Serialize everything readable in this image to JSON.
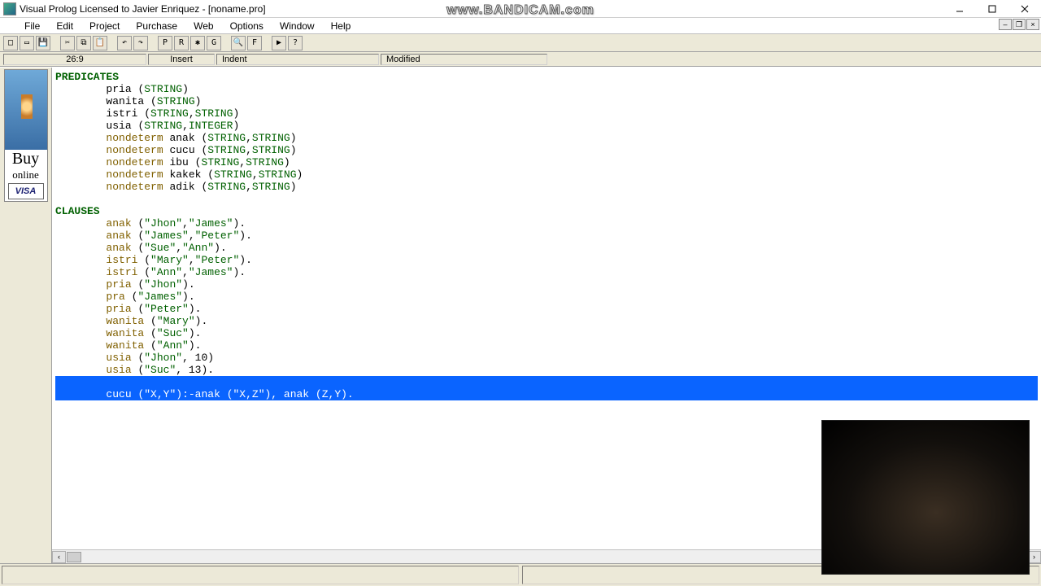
{
  "window": {
    "title": "Visual Prolog Licensed to Javier Enriquez - [noname.pro]",
    "watermark": "www.BANDICAM.com"
  },
  "menu": {
    "file": "File",
    "edit": "Edit",
    "project": "Project",
    "purchase": "Purchase",
    "web": "Web",
    "options": "Options",
    "window": "Window",
    "help": "Help"
  },
  "status": {
    "position": "26:9",
    "insert_mode": "Insert",
    "indent_mode": "Indent",
    "modified": "Modified"
  },
  "ad": {
    "buy": "Buy",
    "online": "online",
    "visa": "VISA"
  },
  "toolbar": {
    "new": "□",
    "open": "▭",
    "save": "💾",
    "cut": "✂",
    "copy": "⧉",
    "paste": "📋",
    "undo": "↶",
    "redo": "↷",
    "p": "P",
    "r": "R",
    "bug": "✱",
    "g": "G",
    "find": "🔍",
    "f": "F",
    "run": "▶",
    "help": "?"
  },
  "code": {
    "predicates_header": "PREDICATES",
    "predicates": [
      {
        "indent": "        ",
        "name": "pria",
        "sig": " (",
        "types": [
          "STRING"
        ],
        "close": ")"
      },
      {
        "indent": "        ",
        "name": "wanita",
        "sig": " (",
        "types": [
          "STRING"
        ],
        "close": ")"
      },
      {
        "indent": "        ",
        "name": "istri",
        "sig": " (",
        "types": [
          "STRING",
          "STRING"
        ],
        "close": ")"
      },
      {
        "indent": "        ",
        "name": "usia",
        "sig": " (",
        "types": [
          "STRING",
          "INTEGER"
        ],
        "close": ")"
      },
      {
        "indent": "        ",
        "nondeterm": true,
        "name": "anak",
        "sig": " (",
        "types": [
          "STRING",
          "STRING"
        ],
        "close": ")"
      },
      {
        "indent": "        ",
        "nondeterm": true,
        "name": "cucu",
        "sig": " (",
        "types": [
          "STRING",
          "STRING"
        ],
        "close": ")"
      },
      {
        "indent": "        ",
        "nondeterm": true,
        "name": "ibu",
        "sig": " (",
        "types": [
          "STRING",
          "STRING"
        ],
        "close": ")"
      },
      {
        "indent": "        ",
        "nondeterm": true,
        "name": "kakek",
        "sig": " (",
        "types": [
          "STRING",
          "STRING"
        ],
        "close": ")"
      },
      {
        "indent": "        ",
        "nondeterm": true,
        "name": "adik",
        "sig": " (",
        "types": [
          "STRING",
          "STRING"
        ],
        "close": ")"
      }
    ],
    "clauses_header": "CLAUSES",
    "clauses": [
      {
        "pred": "anak",
        "args": [
          "\"Jhon\"",
          "\"James\""
        ],
        "dot": "."
      },
      {
        "pred": "anak",
        "args": [
          "\"James\"",
          "\"Peter\""
        ],
        "dot": "."
      },
      {
        "pred": "anak",
        "args": [
          "\"Sue\"",
          "\"Ann\""
        ],
        "dot": "."
      },
      {
        "pred": "istri",
        "args": [
          "\"Mary\"",
          "\"Peter\""
        ],
        "dot": "."
      },
      {
        "pred": "istri",
        "args": [
          "\"Ann\"",
          "\"James\""
        ],
        "dot": "."
      },
      {
        "pred": "pria",
        "args": [
          "\"Jhon\""
        ],
        "dot": "."
      },
      {
        "pred": "pra",
        "args": [
          "\"James\""
        ],
        "dot": "."
      },
      {
        "pred": "pria",
        "args": [
          "\"Peter\""
        ],
        "dot": "."
      },
      {
        "pred": "wanita",
        "args": [
          "\"Mary\""
        ],
        "dot": "."
      },
      {
        "pred": "wanita",
        "args": [
          "\"Suc\""
        ],
        "dot": "."
      },
      {
        "pred": "wanita",
        "args": [
          "\"Ann\""
        ],
        "dot": "."
      },
      {
        "pred": "usia",
        "args": [
          "\"Jhon\"",
          " 10"
        ],
        "dot": ""
      },
      {
        "pred": "usia",
        "args": [
          "\"Suc\"",
          " 13"
        ],
        "dot": "."
      }
    ],
    "selected_rule": {
      "indent": "        ",
      "head_pred": "cucu",
      "head_args": "(\"X,Y\")",
      "neck": ":-",
      "body1_pred": "anak",
      "body1_args": " (\"X,Z\"), ",
      "body2_pred": "anak",
      "body2_args": " (Z,Y).",
      "trail": " "
    }
  }
}
